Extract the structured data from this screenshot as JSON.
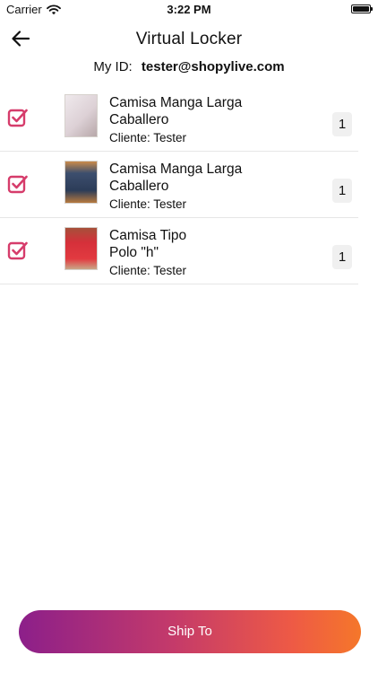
{
  "status_bar": {
    "carrier": "Carrier",
    "time": "3:22 PM",
    "icons": [
      "wifi-icon",
      "battery-icon"
    ]
  },
  "header": {
    "title": "Virtual Locker",
    "back_icon": "back-arrow-icon"
  },
  "my_id": {
    "label": "My ID:",
    "value": "tester@shopylive.com"
  },
  "items": [
    {
      "name": "Camisa Manga Larga\nCaballero",
      "client": "Cliente: Tester",
      "quantity": "1",
      "checked": true,
      "checkbox_icon": "checked-checkbox-icon",
      "image_icon": "shirt-photo-thumbnail"
    },
    {
      "name": "Camisa Manga Larga\nCaballero",
      "client": "Cliente: Tester",
      "quantity": "1",
      "checked": true,
      "checkbox_icon": "checked-checkbox-icon",
      "image_icon": "shirt-photo-thumbnail"
    },
    {
      "name": "Camisa Tipo\nPolo \"h\"",
      "client": "Cliente: Tester",
      "quantity": "1",
      "checked": true,
      "checkbox_icon": "checked-checkbox-icon",
      "image_icon": "shirt-photo-thumbnail"
    }
  ],
  "ship_button": {
    "label": "Ship To"
  },
  "colors": {
    "checkbox": "#d63c6b",
    "button_gradient_start": "#8c1f8a",
    "button_gradient_end": "#f5772a"
  }
}
